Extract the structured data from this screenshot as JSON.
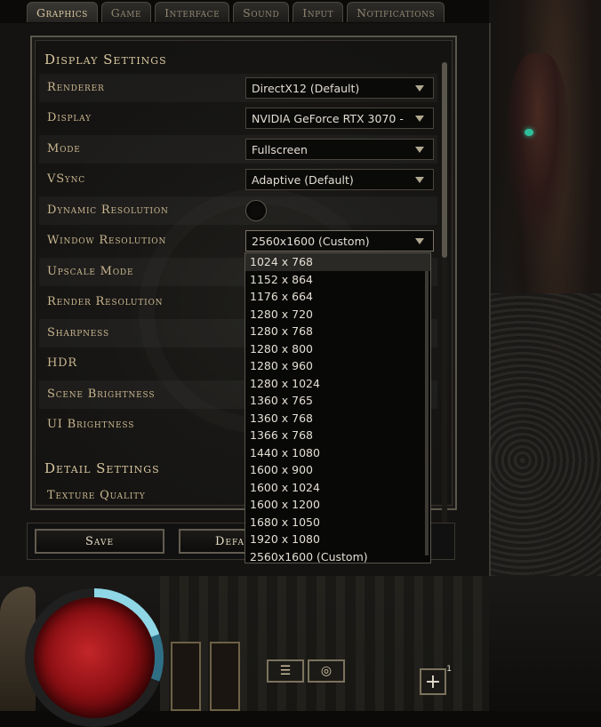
{
  "tabs": [
    {
      "label": "Graphics",
      "active": true
    },
    {
      "label": "Game",
      "active": false
    },
    {
      "label": "Interface",
      "active": false
    },
    {
      "label": "Sound",
      "active": false
    },
    {
      "label": "Input",
      "active": false
    },
    {
      "label": "Notifications",
      "active": false
    }
  ],
  "display_settings": {
    "title": "Display Settings",
    "renderer": {
      "label": "Renderer",
      "value": "DirectX12 (Default)"
    },
    "display": {
      "label": "Display",
      "value": "NVIDIA GeForce RTX 3070 -"
    },
    "mode": {
      "label": "Mode",
      "value": "Fullscreen"
    },
    "vsync": {
      "label": "VSync",
      "value": "Adaptive (Default)"
    },
    "dynamic_resolution": {
      "label": "Dynamic Resolution",
      "enabled": false
    },
    "window_resolution": {
      "label": "Window Resolution",
      "value": "2560x1600 (Custom)"
    },
    "upscale_mode": {
      "label": "Upscale Mode"
    },
    "render_resolution": {
      "label": "Render Resolution"
    },
    "sharpness": {
      "label": "Sharpness"
    },
    "hdr": {
      "label": "HDR"
    },
    "scene_brightness": {
      "label": "Scene Brightness"
    },
    "ui_brightness": {
      "label": "UI Brightness"
    }
  },
  "detail_settings": {
    "title": "Detail Settings",
    "texture_quality": {
      "label": "Texture Quality"
    }
  },
  "resolution_options": [
    "1024 x 768",
    "1152 x 864",
    "1176 x 664",
    "1280 x 720",
    "1280 x 768",
    "1280 x 800",
    "1280 x 960",
    "1280 x 1024",
    "1360 x 765",
    "1360 x 768",
    "1366 x 768",
    "1440 x 1080",
    "1600 x 900",
    "1600 x 1024",
    "1600 x 1200",
    "1680 x 1050",
    "1920 x 1080",
    "2560x1600 (Custom)"
  ],
  "highlighted_option": "1024 x 768",
  "buttons": {
    "save": "Save",
    "defaults": "Defa"
  },
  "hud": {
    "plus_badge": "1",
    "menu_icon": "menu-icon",
    "coins_icon": "coins-icon"
  },
  "colors": {
    "accent": "#c9b690",
    "health": "#c3262a",
    "mana_ring": "#8fd6e6"
  }
}
